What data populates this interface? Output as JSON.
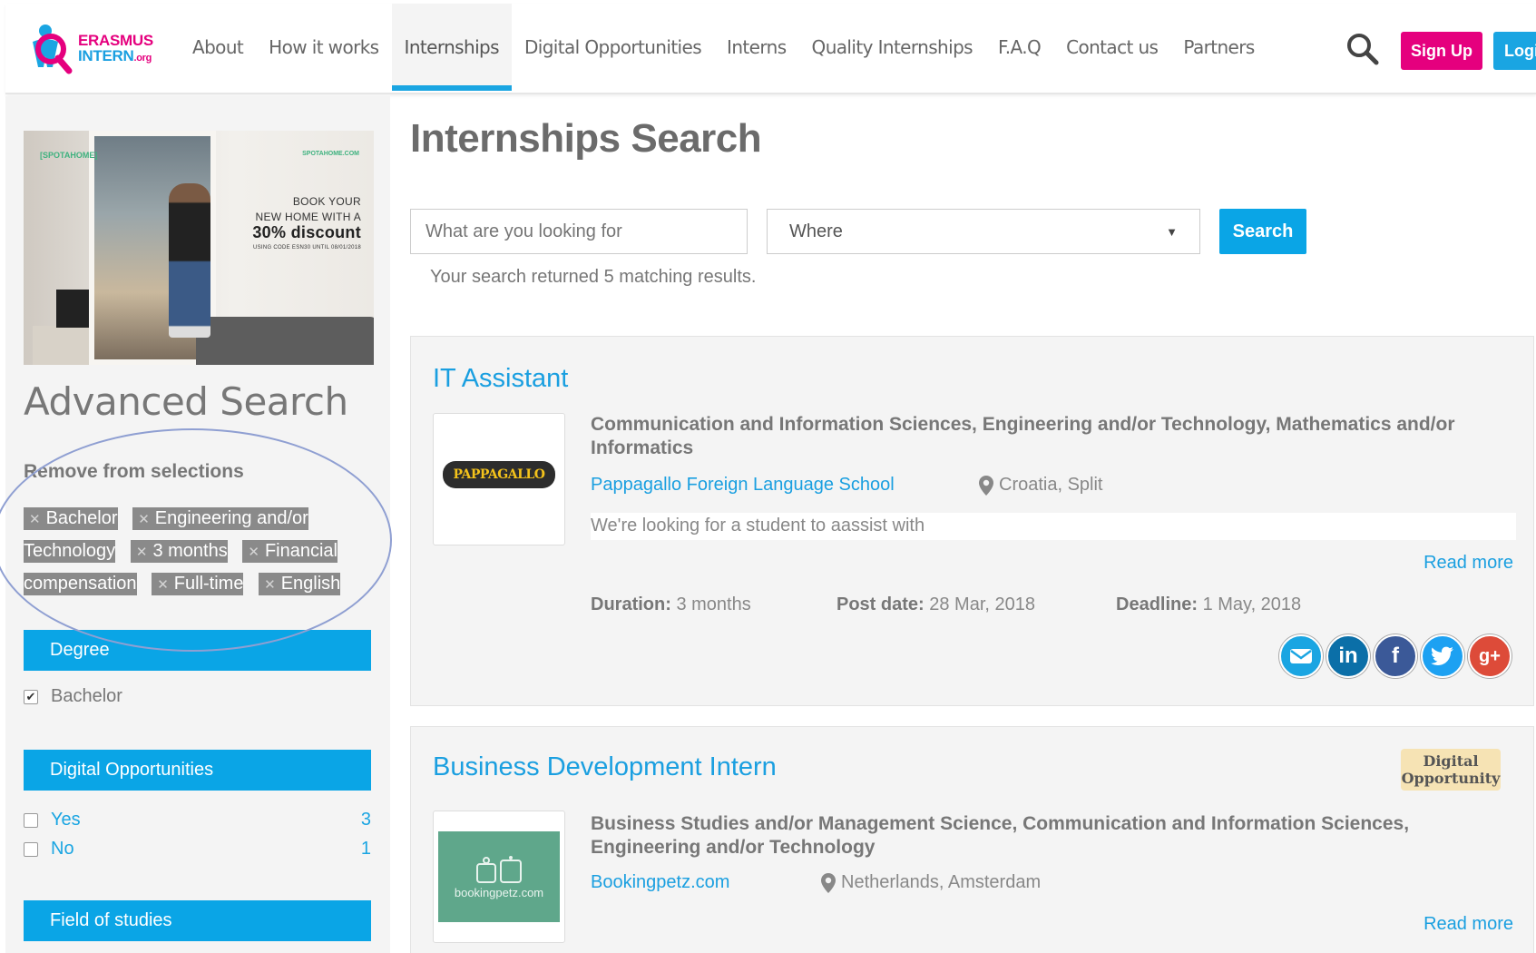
{
  "header": {
    "logo": {
      "line1": "ERASMUS",
      "line2": "INTERN",
      "suffix": ".org"
    },
    "nav": [
      "About",
      "How it works",
      "Internships",
      "Digital Opportunities",
      "Interns",
      "Quality Internships",
      "F.A.Q",
      "Contact us",
      "Partners"
    ],
    "active_nav": "Internships",
    "signup_label": "Sign Up",
    "login_label": "Login",
    "brand_colors": {
      "pink": "#e5007e",
      "blue": "#1aa5e2"
    }
  },
  "ad": {
    "brand_left": "[SPOTAHOME]",
    "brand_right": "SPOTAHOME.COM",
    "line1": "BOOK YOUR",
    "line2": "NEW HOME WITH A",
    "line3": "30% discount",
    "line4": "USING CODE ESN30 UNTIL 08/01/2018"
  },
  "sidebar": {
    "title": "Advanced Search",
    "remove_title": "Remove from selections",
    "chips": [
      "Bachelor",
      "Engineering and/or Technology",
      "3 months",
      "Financial compensation",
      "Full-time",
      "English"
    ],
    "degree": {
      "header": "Degree",
      "option": "Bachelor",
      "checked": true
    },
    "digital": {
      "header": "Digital Opportunities",
      "options": [
        {
          "label": "Yes",
          "count": "3"
        },
        {
          "label": "No",
          "count": "1"
        }
      ]
    },
    "field_header": "Field of studies"
  },
  "main": {
    "title": "Internships Search",
    "query_placeholder": "What are you looking for",
    "where_value": "Where",
    "search_label": "Search",
    "results_text": "Your search returned 5 matching results."
  },
  "listings": [
    {
      "title": "IT Assistant",
      "logo_text": "PAPPAGALLO",
      "fields": "Communication and Information Sciences, Engineering and/or Technology, Mathematics and/or Informatics",
      "company": "Pappagallo Foreign Language School",
      "location": "Croatia, Split",
      "description": "We're looking for a student to aassist with",
      "read_more": "Read more",
      "duration_label": "Duration:",
      "duration": "3 months",
      "post_label": "Post date:",
      "post_date": "28 Mar, 2018",
      "deadline_label": "Deadline:",
      "deadline": "1 May, 2018"
    },
    {
      "title": "Business Development Intern",
      "badge": "Digital Opportunity",
      "logo_text": "bookingpetz.com",
      "fields": "Business Studies and/or Management Science, Communication and Information Sciences, Engineering and/or Technology",
      "company": "Bookingpetz.com",
      "location": "Netherlands, Amsterdam",
      "read_more": "Read more"
    }
  ],
  "share_icons": [
    "email-icon",
    "linkedin-icon",
    "facebook-icon",
    "twitter-icon",
    "google-plus-icon"
  ]
}
